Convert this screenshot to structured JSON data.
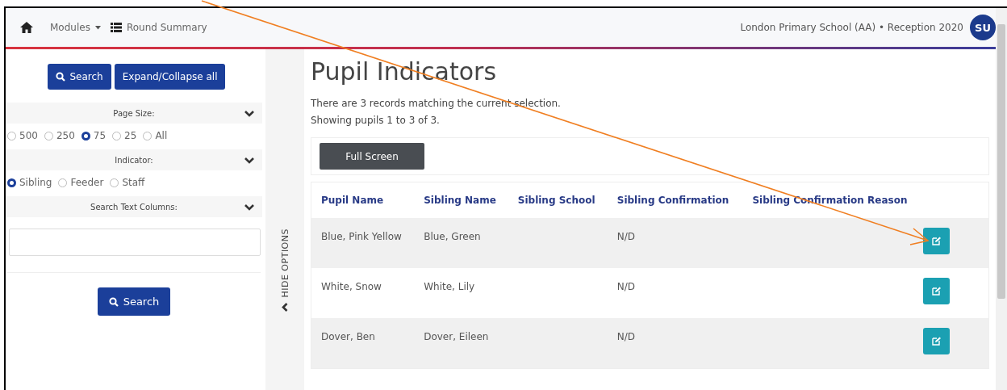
{
  "navbar": {
    "menu": [
      {
        "kind": "dropdown",
        "label": "Modules"
      },
      {
        "kind": "link",
        "label": "Round Summary"
      }
    ],
    "context": "London Primary School (AA) • Reception 2020",
    "avatar": "SU"
  },
  "sidebar": {
    "buttons": [
      {
        "kind": "search",
        "label": "Search"
      },
      {
        "kind": "plain",
        "label": "Expand/Collapse all"
      }
    ],
    "sections": [
      {
        "kind": "radios",
        "title": "Page Size:",
        "options": [
          {
            "label": "500",
            "selected": false
          },
          {
            "label": "250",
            "selected": false
          },
          {
            "label": "75",
            "selected": true
          },
          {
            "label": "25",
            "selected": false
          },
          {
            "label": "All",
            "selected": false
          }
        ]
      },
      {
        "kind": "radios",
        "title": "Indicator:",
        "options": [
          {
            "label": "Sibling",
            "selected": true
          },
          {
            "label": "Feeder",
            "selected": false
          },
          {
            "label": "Staff",
            "selected": false
          }
        ]
      },
      {
        "kind": "text",
        "title": "Search Text Columns:"
      }
    ],
    "search_button": "Search"
  },
  "toggle": "HIDE OPTIONS",
  "main": {
    "title": "Pupil Indicators",
    "summary": [
      "There are 3 records matching the current selection.",
      "Showing pupils 1 to 3 of 3."
    ],
    "full_screen_button": "Full Screen",
    "table": {
      "columns": [
        "Pupil Name",
        "Sibling Name",
        "Sibling School",
        "Sibling Confirmation",
        "Sibling Confirmation Reason"
      ],
      "rows": [
        [
          "Blue, Pink Yellow",
          "Blue, Green",
          "",
          "N/D",
          ""
        ],
        [
          "White, Snow",
          "White, Lily",
          "",
          "N/D",
          ""
        ],
        [
          "Dover, Ben",
          "Dover, Eileen",
          "",
          "N/D",
          ""
        ]
      ]
    }
  }
}
